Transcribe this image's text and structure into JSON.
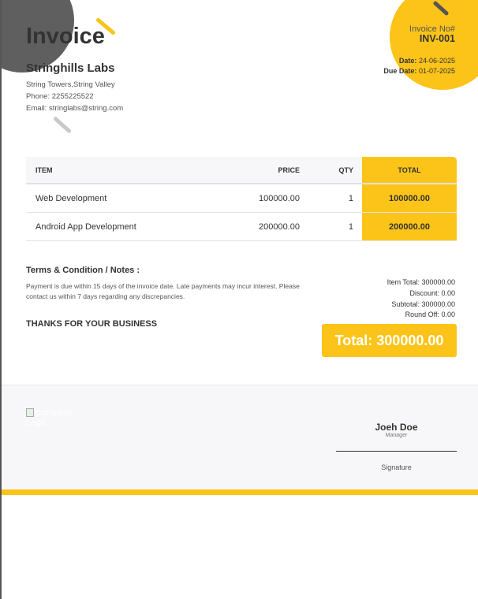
{
  "header": {
    "title": "Invoice",
    "company_name": "Stringhills Labs",
    "address": "String Towers,String Valley",
    "phone": "Phone: 2255225522",
    "email": "Email: stringlabs@string.com",
    "invoice_no_label": "Invoice No#",
    "invoice_no": "INV-001",
    "date_label": "Date:",
    "date": "24-06-2025",
    "due_label": "Due Date:",
    "due_date": "01-07-2025"
  },
  "table": {
    "columns": [
      "ITEM",
      "PRICE",
      "QTY",
      "TOTAL"
    ],
    "rows": [
      {
        "item": "Web Development",
        "price": "100000.00",
        "qty": "1",
        "total": "100000.00"
      },
      {
        "item": "Android App Development",
        "price": "200000.00",
        "qty": "1",
        "total": "200000.00"
      }
    ]
  },
  "notes": {
    "title": "Terms & Condition / Notes :",
    "text": "Payment is due within 15 days of the invoice date. Late payments may incur interest. Please contact us within 7 days regarding any discrepancies.",
    "thanks": "THANKS FOR YOUR BUSINESS"
  },
  "summary": {
    "item_total": "Item Total: 300000.00",
    "discount": "Discount: 0.00",
    "subtotal": "Subtotal: 300000.00",
    "round_off": "Round Off: 0.00",
    "grand_total": "Total: 300000.00"
  },
  "footer": {
    "logo_alt": "Company Logo",
    "signer_name": "Joeh Doe",
    "signer_role": "Manager",
    "signature_label": "Signature"
  },
  "colors": {
    "accent": "#fcc419",
    "dark": "#5f5f5f",
    "text": "#333333"
  }
}
